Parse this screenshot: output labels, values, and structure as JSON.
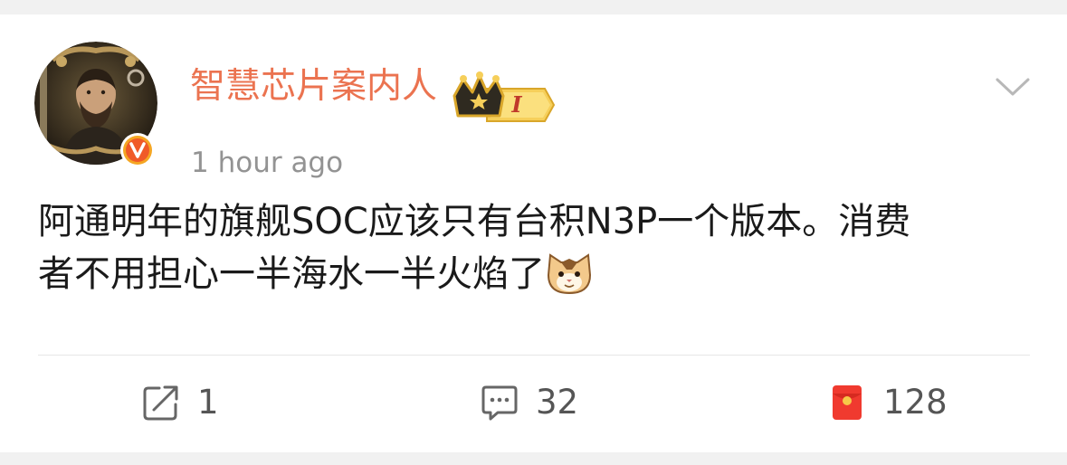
{
  "post": {
    "author": {
      "name": "智慧芯片案内人",
      "badge_level": "I",
      "verified_mark": "V"
    },
    "timestamp": "1 hour ago",
    "content": {
      "line1": "阿通明年的旗舰SOC应该只有台积N3P一个版本。消费",
      "line2": "者不用担心一半海水一半火焰了"
    },
    "icons": {
      "menu": "chevron-down-icon",
      "repost": "repost-icon",
      "comment": "comment-icon",
      "like": "red-envelope-like-icon",
      "emoji": "cat-emoji"
    }
  },
  "actions": {
    "repost_count": "1",
    "comment_count": "32",
    "like_count": "128"
  },
  "colors": {
    "username": "#eb7350",
    "timestamp": "#939393",
    "text": "#1a1a1a",
    "like_red": "#f03a2f",
    "background": "#f1f1f1"
  }
}
